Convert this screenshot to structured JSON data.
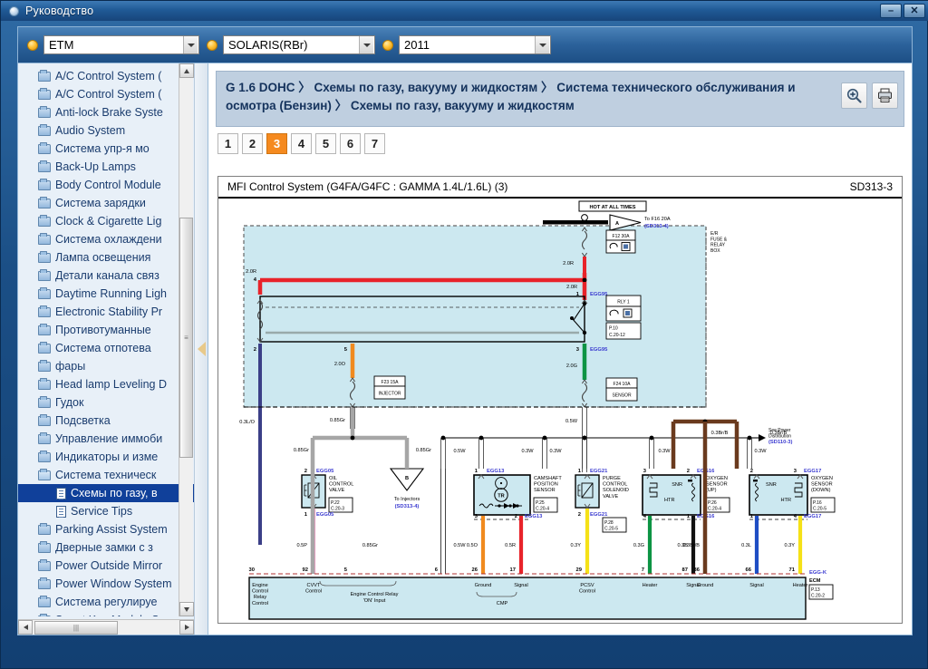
{
  "window": {
    "title": "Руководство",
    "title_icon": "app-sphere-icon",
    "minimize_label": "–",
    "close_label": "✕"
  },
  "toolbar": {
    "selectors": [
      {
        "name": "etm",
        "value": "ETM",
        "bullet": "orange-bullet-icon"
      },
      {
        "name": "model",
        "value": "SOLARIS(RBr)",
        "bullet": "orange-bullet-icon"
      },
      {
        "name": "year",
        "value": "2011",
        "bullet": "orange-bullet-icon"
      }
    ]
  },
  "sidebar": {
    "items": [
      {
        "label": "A/C Control System (",
        "icon": "folder-icon",
        "level": 0,
        "selected": false
      },
      {
        "label": "A/C Control System (",
        "icon": "folder-icon",
        "level": 0,
        "selected": false
      },
      {
        "label": "Anti-lock Brake Syste",
        "icon": "folder-icon",
        "level": 0,
        "selected": false
      },
      {
        "label": "Audio System",
        "icon": "folder-icon",
        "level": 0,
        "selected": false
      },
      {
        "label": "Система упр-я мо",
        "icon": "folder-icon",
        "level": 0,
        "selected": false
      },
      {
        "label": "Back-Up Lamps",
        "icon": "folder-icon",
        "level": 0,
        "selected": false
      },
      {
        "label": "Body Control Module",
        "icon": "folder-icon",
        "level": 0,
        "selected": false
      },
      {
        "label": "Система зарядки",
        "icon": "folder-icon",
        "level": 0,
        "selected": false
      },
      {
        "label": "Clock & Cigarette Lig",
        "icon": "folder-icon",
        "level": 0,
        "selected": false
      },
      {
        "label": "Система охлаждени",
        "icon": "folder-icon",
        "level": 0,
        "selected": false
      },
      {
        "label": "Лампа освещения",
        "icon": "folder-icon",
        "level": 0,
        "selected": false
      },
      {
        "label": "Детали канала связ",
        "icon": "folder-icon",
        "level": 0,
        "selected": false
      },
      {
        "label": "Daytime Running Ligh",
        "icon": "folder-icon",
        "level": 0,
        "selected": false
      },
      {
        "label": "Electronic Stability Pr",
        "icon": "folder-icon",
        "level": 0,
        "selected": false
      },
      {
        "label": "Противотуманные",
        "icon": "folder-icon",
        "level": 0,
        "selected": false
      },
      {
        "label": "Система отпотева",
        "icon": "folder-icon",
        "level": 0,
        "selected": false
      },
      {
        "label": "фары",
        "icon": "folder-icon",
        "level": 0,
        "selected": false
      },
      {
        "label": "Head lamp Leveling D",
        "icon": "folder-icon",
        "level": 0,
        "selected": false
      },
      {
        "label": "Гудок",
        "icon": "folder-icon",
        "level": 0,
        "selected": false
      },
      {
        "label": "Подсветка",
        "icon": "folder-icon",
        "level": 0,
        "selected": false
      },
      {
        "label": "Управление иммоби",
        "icon": "folder-icon",
        "level": 0,
        "selected": false
      },
      {
        "label": "Индикаторы и изме",
        "icon": "folder-icon",
        "level": 0,
        "selected": false
      },
      {
        "label": "Система техническ",
        "icon": "folder-open-icon",
        "level": 0,
        "selected": false
      },
      {
        "label": "Схемы по газу, в",
        "icon": "document-icon",
        "level": 1,
        "selected": true
      },
      {
        "label": "Service Tips",
        "icon": "document-icon",
        "level": 1,
        "selected": false
      },
      {
        "label": "Parking Assist System",
        "icon": "folder-icon",
        "level": 0,
        "selected": false
      },
      {
        "label": "Дверные замки с з",
        "icon": "folder-icon",
        "level": 0,
        "selected": false
      },
      {
        "label": "Power Outside Mirror",
        "icon": "folder-icon",
        "level": 0,
        "selected": false
      },
      {
        "label": "Power Window System",
        "icon": "folder-icon",
        "level": 0,
        "selected": false
      },
      {
        "label": "Система регулируе",
        "icon": "folder-icon",
        "level": 0,
        "selected": false
      },
      {
        "label": "Smart Key Module Sy",
        "icon": "folder-icon",
        "level": 0,
        "selected": false
      }
    ],
    "scroll_up_icon": "scroll-up-arrow-icon",
    "scroll_down_icon": "scroll-down-arrow-icon",
    "scroll_left_icon": "scroll-left-arrow-icon",
    "scroll_right_icon": "scroll-right-arrow-icon",
    "splitter_icon": "collapse-left-arrow-icon"
  },
  "main": {
    "breadcrumb": "G 1.6 DOHC 〉 Схемы по газу, вакууму и жидкостям 〉 Система технического обслуживания и осмотра (Бензин) 〉 Схемы по газу, вакууму и жидкостям",
    "zoom_icon": "zoom-in-magnifier-icon",
    "print_icon": "printer-icon",
    "tabs": [
      {
        "label": "1",
        "active": false
      },
      {
        "label": "2",
        "active": false
      },
      {
        "label": "3",
        "active": true
      },
      {
        "label": "4",
        "active": false
      },
      {
        "label": "5",
        "active": false
      },
      {
        "label": "6",
        "active": false
      },
      {
        "label": "7",
        "active": false
      }
    ]
  },
  "diagram": {
    "title": "MFI Control System (G4FA/G4FC : GAMMA 1.4L/1.6L) (3)",
    "doc_id": "SD313-3",
    "hot_label": "HOT AT ALL TIMES",
    "fuse_box_lines": [
      "E/R",
      "FUSE &",
      "RELAY",
      "BOX"
    ],
    "connector_a": {
      "letter": "A",
      "to": "To F16 20A",
      "ref": "(SD313-4)"
    },
    "connector_b": {
      "letter": "B",
      "to": "To Injectors",
      "ref": "(SD313-4)"
    },
    "fuses": [
      {
        "id": "F12 30A",
        "name": ""
      },
      {
        "id": "F23 15A",
        "name": "INJECTOR"
      },
      {
        "id": "F24 10A",
        "name": "SENSOR"
      }
    ],
    "relay": {
      "label": "RLY 1",
      "pin": "P.10",
      "conn": "C.20-12"
    },
    "power_ref": [
      "See Power",
      "Distribution",
      "(SD110-3)"
    ],
    "egg_labels": [
      "EGG95",
      "EGG95",
      "EGG05",
      "EGG05",
      "EGG13",
      "EGG13",
      "EGG21",
      "EGG21",
      "EGG16",
      "EGG16",
      "EGG17",
      "EGG17",
      "EGG-K"
    ],
    "components": [
      {
        "name": "OIL CONTROL VALVE",
        "lines": [
          "OIL",
          "CONTROL",
          "VALVE"
        ],
        "pin": "P.22",
        "conn": "C.20-3",
        "top_pin": "2",
        "bottom_pin": "1",
        "conn_id": "EGG05"
      },
      {
        "name": "CAMSHAFT POSITION SENSOR",
        "lines": [
          "CAMSHAFT",
          "POSITION",
          "SENSOR"
        ],
        "pin": "P.25",
        "conn": "C.20-4",
        "top_pin": "1",
        "bottom_pins": [
          "3",
          "2"
        ],
        "conn_id": "EGG13",
        "inner": "TR"
      },
      {
        "name": "PURGE CONTROL SOLENOID VALVE",
        "lines": [
          "PURGE",
          "CONTROL",
          "SOLENOID",
          "VALVE"
        ],
        "pin": "P.28",
        "conn": "C.20-5",
        "top_pin": "1",
        "bottom_pin": "2",
        "conn_id": "EGG21"
      },
      {
        "name": "OXYGEN SENSOR (UP)",
        "lines": [
          "OXYGEN",
          "SENSOR",
          "(UP)"
        ],
        "pin": "P.26",
        "conn": "C.20-4",
        "top_pins": [
          "3",
          "2"
        ],
        "bottom_pins": [
          "4",
          "1"
        ],
        "conn_id": "EGG16",
        "tags": [
          "SNR",
          "HTR"
        ]
      },
      {
        "name": "OXYGEN SENSOR (DOWN)",
        "lines": [
          "OXYGEN",
          "SENSOR",
          "(DOWN)"
        ],
        "pin": "P.16",
        "conn": "C.20-5",
        "top_pins": [
          "2",
          "3"
        ],
        "bottom_pins": [
          "1",
          "4"
        ],
        "conn_id": "EGG17",
        "tags": [
          "SNR",
          "HTR"
        ]
      }
    ],
    "wire_gauges_upper": [
      "2.0R",
      "2.0R",
      "2.0O",
      "2.0G"
    ],
    "wire_gauges_mid": [
      "0.3L/O",
      "0.85Gr",
      "0.85Gr",
      "0.85Gr",
      "0.5W",
      "0.5W",
      "0.3W",
      "0.3W",
      "0.3W",
      "0.3Br/B",
      "0.3Br/B",
      "0.3W"
    ],
    "wire_gauges_lower": [
      "0.5P",
      "0.85Gr",
      "0.5W",
      "0.5O",
      "0.5R",
      "0.3Y",
      "0.3G",
      "0.3B",
      "0.3Br/B",
      "0.3L",
      "0.3Y"
    ],
    "ecm": {
      "label": "ECM",
      "pin": "P.13",
      "conn": "C.20-2",
      "terminals": [
        {
          "pin": "30",
          "lines": [
            "Engine",
            "Control",
            "Relay",
            "Control"
          ]
        },
        {
          "pin": "92",
          "lines": [
            "CVVT",
            "Control"
          ]
        },
        {
          "pin": "5",
          "lines": []
        },
        {
          "pin": "6",
          "lines": []
        },
        {
          "pin": "26",
          "lines": [
            "Ground"
          ]
        },
        {
          "pin": "17",
          "lines": [
            "Signal"
          ]
        },
        {
          "pin": "29",
          "lines": [
            "PCSV",
            "Control"
          ]
        },
        {
          "pin": "7",
          "lines": [
            "Heater"
          ]
        },
        {
          "pin": "87",
          "lines": [
            "Signal"
          ]
        },
        {
          "pin": "86",
          "lines": [
            "Ground"
          ]
        },
        {
          "pin": "66",
          "lines": [
            "Signal"
          ]
        },
        {
          "pin": "71",
          "lines": [
            "Heater"
          ]
        }
      ],
      "group_labels": [
        {
          "text": "Engine Control Relay",
          "sub": "'ON' Input"
        },
        {
          "text": "CMP",
          "sub": ""
        }
      ]
    }
  },
  "colors": {
    "accent_orange": "#f58a1f",
    "selection_blue": "#10409a",
    "title_blue": "#205a96",
    "diagram_fill": "#cce8f0"
  }
}
